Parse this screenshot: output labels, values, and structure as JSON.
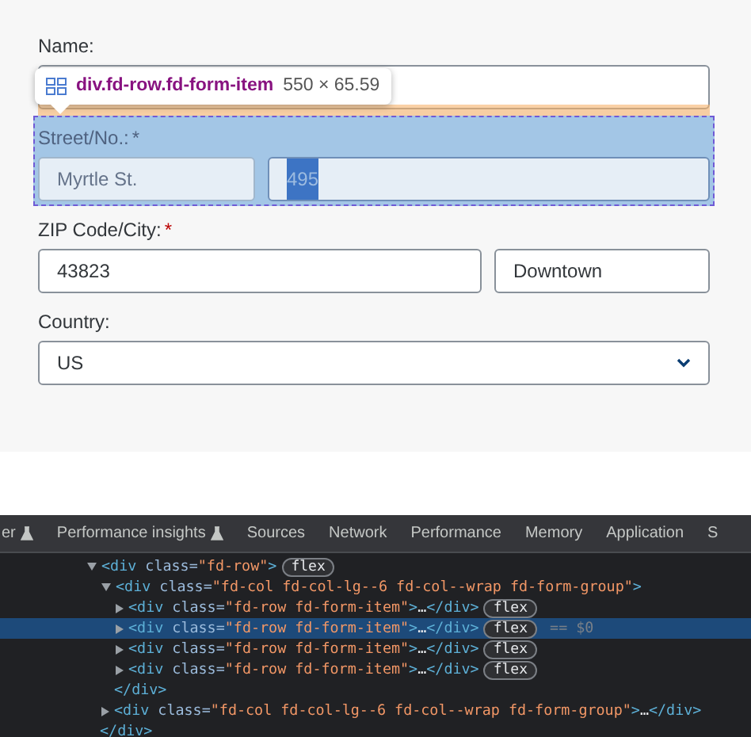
{
  "form": {
    "items": [
      {
        "label": "Name:",
        "highlighted": false,
        "fields": [
          {
            "text_selected": false
          }
        ]
      },
      {
        "label": "Street/No.:",
        "required_mark": "*",
        "highlighted": true,
        "fields": [
          {
            "value": "Myrtle St.",
            "text_selected": false
          },
          {
            "value": "495",
            "text_selected": true
          }
        ]
      },
      {
        "label": "ZIP Code/City:",
        "required_mark": "*",
        "highlighted": false,
        "fields": [
          {
            "value": "43823",
            "text_selected": false
          },
          {
            "value": "Downtown",
            "text_selected": false
          }
        ]
      },
      {
        "label": "Country:",
        "highlighted": false,
        "kind": "select",
        "fields": [
          {
            "value": "US",
            "text_selected": false
          }
        ]
      }
    ],
    "tooltip": {
      "selector": "div.fd-row.fd-form-item",
      "size": "550 × 65.59"
    }
  },
  "devtools": {
    "tabs": [
      {
        "label": "er",
        "experimental": true
      },
      {
        "label": "Performance insights",
        "experimental": true
      },
      {
        "label": "Sources",
        "experimental": false
      },
      {
        "label": "Network",
        "experimental": false
      },
      {
        "label": "Performance",
        "experimental": false
      },
      {
        "label": "Memory",
        "experimental": false
      },
      {
        "label": "Application",
        "experimental": false
      },
      {
        "label": "S",
        "experimental": false
      }
    ],
    "tree": [
      {
        "kind": "element",
        "expanded": true,
        "selected": false,
        "badge": "flex",
        "segments": [
          {
            "kind": "tag",
            "text": "<div"
          },
          {
            "kind": "attr",
            "text": " class="
          },
          {
            "kind": "value",
            "text": "\"fd-row\""
          },
          {
            "kind": "tag",
            "text": ">"
          }
        ],
        "children": [
          {
            "kind": "element",
            "expanded": true,
            "selected": false,
            "segments": [
              {
                "kind": "tag",
                "text": "<div"
              },
              {
                "kind": "attr",
                "text": " class="
              },
              {
                "kind": "value",
                "text": "\"fd-col fd-col-lg--6 fd-col--wrap fd-form-group\""
              },
              {
                "kind": "tag",
                "text": ">"
              }
            ],
            "children": [
              {
                "kind": "element",
                "expanded": false,
                "selected": false,
                "badge": "flex",
                "segments": [
                  {
                    "kind": "tag",
                    "text": "<div"
                  },
                  {
                    "kind": "attr",
                    "text": " class="
                  },
                  {
                    "kind": "value",
                    "text": "\"fd-row fd-form-item\""
                  },
                  {
                    "kind": "tag",
                    "text": ">"
                  },
                  {
                    "kind": "text",
                    "text": "…"
                  },
                  {
                    "kind": "tag",
                    "text": "</div>"
                  }
                ]
              },
              {
                "kind": "element",
                "expanded": false,
                "selected": true,
                "badge": "flex",
                "ref": "== $0",
                "segments": [
                  {
                    "kind": "tag",
                    "text": "<div"
                  },
                  {
                    "kind": "attr",
                    "text": " class="
                  },
                  {
                    "kind": "value",
                    "text": "\"fd-row fd-form-item\""
                  },
                  {
                    "kind": "tag",
                    "text": ">"
                  },
                  {
                    "kind": "text",
                    "text": "…"
                  },
                  {
                    "kind": "tag",
                    "text": "</div>"
                  }
                ]
              },
              {
                "kind": "element",
                "expanded": false,
                "selected": false,
                "badge": "flex",
                "segments": [
                  {
                    "kind": "tag",
                    "text": "<div"
                  },
                  {
                    "kind": "attr",
                    "text": " class="
                  },
                  {
                    "kind": "value",
                    "text": "\"fd-row fd-form-item\""
                  },
                  {
                    "kind": "tag",
                    "text": ">"
                  },
                  {
                    "kind": "text",
                    "text": "…"
                  },
                  {
                    "kind": "tag",
                    "text": "</div>"
                  }
                ]
              },
              {
                "kind": "element",
                "expanded": false,
                "selected": false,
                "badge": "flex",
                "segments": [
                  {
                    "kind": "tag",
                    "text": "<div"
                  },
                  {
                    "kind": "attr",
                    "text": " class="
                  },
                  {
                    "kind": "value",
                    "text": "\"fd-row fd-form-item\""
                  },
                  {
                    "kind": "tag",
                    "text": ">"
                  },
                  {
                    "kind": "text",
                    "text": "…"
                  },
                  {
                    "kind": "tag",
                    "text": "</div>"
                  }
                ]
              }
            ]
          },
          {
            "kind": "closing",
            "selected": false,
            "segments": [
              {
                "kind": "tag",
                "text": "</div>"
              }
            ]
          },
          {
            "kind": "element",
            "expanded": false,
            "selected": false,
            "segments": [
              {
                "kind": "tag",
                "text": "<div"
              },
              {
                "kind": "attr",
                "text": " class="
              },
              {
                "kind": "value",
                "text": "\"fd-col fd-col-lg--6 fd-col--wrap fd-form-group\""
              },
              {
                "kind": "tag",
                "text": ">"
              },
              {
                "kind": "text",
                "text": "…"
              },
              {
                "kind": "tag",
                "text": "</div>"
              }
            ]
          }
        ]
      },
      {
        "kind": "closing",
        "selected": false,
        "segments": [
          {
            "kind": "tag",
            "text": "</div>"
          }
        ]
      }
    ]
  }
}
